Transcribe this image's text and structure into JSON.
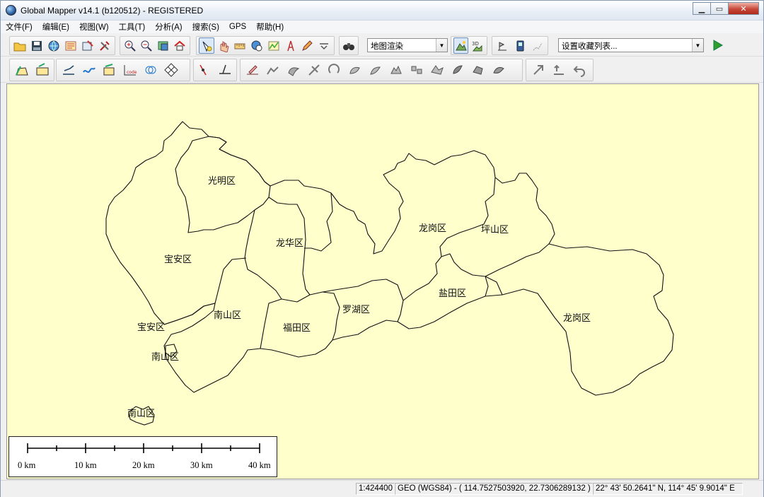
{
  "window": {
    "title": "Global Mapper v14.1 (b120512) - REGISTERED",
    "controls": {
      "minimize": "▁",
      "maximize": "▭",
      "close": "✕"
    }
  },
  "menu": [
    "文件(F)",
    "编辑(E)",
    "视图(W)",
    "工具(T)",
    "分析(A)",
    "搜索(S)",
    "GPS",
    "帮助(H)"
  ],
  "toolbar": {
    "shader_combo": "地图渲染",
    "favorites_combo": "设置收藏列表..."
  },
  "map": {
    "background": "#ffffcc",
    "districts": {
      "guangming": "光明区",
      "baoan": "宝安区",
      "baoan_islet": "宝安区",
      "longhua": "龙华区",
      "longgang_west": "龙岗区",
      "pingshan": "坪山区",
      "nanshan": "南山区",
      "nanshan_islet1": "南山区",
      "nanshan_islet2": "南山区",
      "futian": "福田区",
      "luohu": "罗湖区",
      "yantian": "盐田区",
      "longgang_east": "龙岗区"
    },
    "scale_bar": {
      "labels": [
        "0 km",
        "10 km",
        "20 km",
        "30 km",
        "40 km"
      ]
    }
  },
  "status": {
    "scale": "1:424400",
    "projection": "GEO (WGS84) - ( 114.7527503920, 22.7306289132 )",
    "dms": "22° 43' 50.2641\" N, 114° 45' 9.9014\" E"
  }
}
